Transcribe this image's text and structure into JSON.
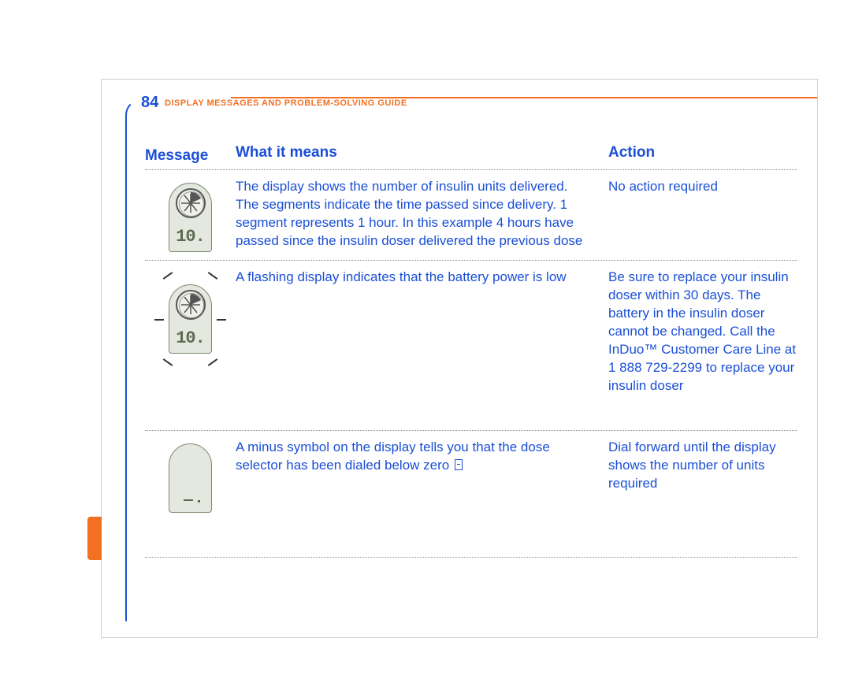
{
  "page_number": "84",
  "section_title": "DISPLAY MESSAGES AND PROBLEM-SOLVING GUIDE",
  "headers": {
    "message": "Message",
    "meaning": "What it means",
    "action": "Action"
  },
  "rows": [
    {
      "icon": "device-dial-10",
      "meaning": "The display shows the number of insulin units delivered. The segments indicate the time passed since delivery. 1 segment represents 1 hour. In this example 4 hours have passed since the insulin doser delivered the previous dose",
      "action": "No action required"
    },
    {
      "icon": "device-dial-10-flashing",
      "meaning": "A flashing display indicates that the battery power is low",
      "action": "Be sure to replace your insulin doser within 30 days. The battery in the insulin doser cannot be changed. Call the InDuo™ Customer Care Line at 1 888 729-2299 to replace your insulin doser"
    },
    {
      "icon": "device-minus",
      "meaning": "A minus symbol on the display tells you that the dose selector has been dialed below zero ",
      "action": "Dial forward until the display shows the number of units required"
    }
  ],
  "device_readout": "10."
}
